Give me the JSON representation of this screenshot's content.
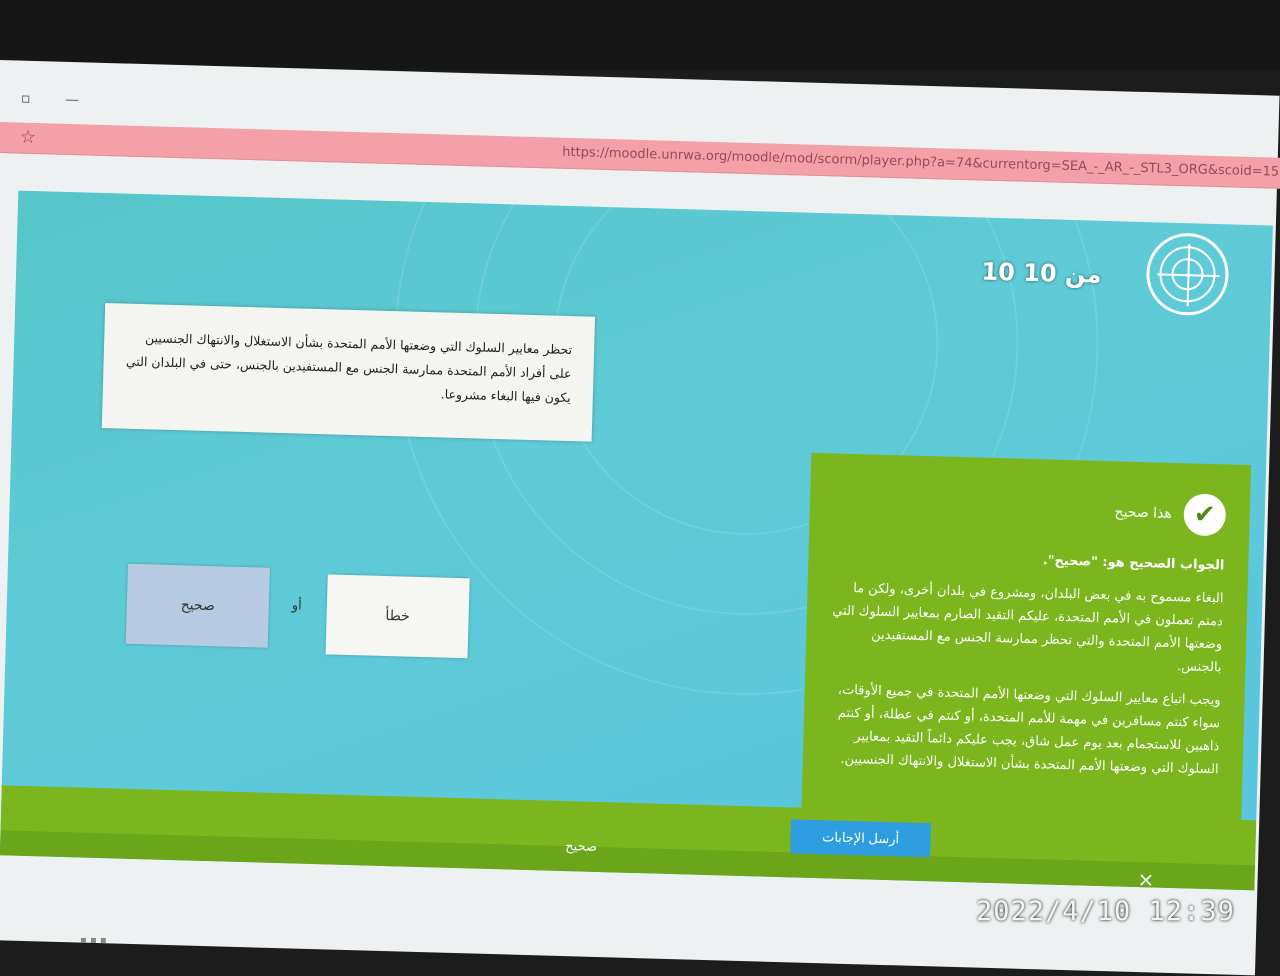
{
  "browser": {
    "url": "https://moodle.unrwa.org/moodle/mod/scorm/player.php?a=74&currentorg=SEA_-_AR_-_STL3_ORG&scoid=155"
  },
  "quiz": {
    "progress": "10 من 10",
    "question": "تحظر معايير السلوك التي وضعتها الأمم المتحدة بشأن الاستغلال والانتهاك الجنسيين على أفراد الأمم المتحدة ممارسة الجنس مع المستفيدين بالجنس، حتى في البلدان التي يكون فيها البغاء مشروعا.",
    "choices": {
      "true_label": "صحيح",
      "or_label": "أو",
      "false_label": "خطأ"
    },
    "feedback": {
      "title": "هذا صحيح",
      "answer": "الجواب الصحيح هو: \"صحيح\".",
      "para1": "البغاء مسموح به في بعض البلدان، ومشروع في بلدان أخرى، ولكن ما دمتم تعملون في الأمم المتحدة، عليكم التقيد الصارم بمعايير السلوك التي وضعتها الأمم المتحدة والتي تحظر ممارسة الجنس مع المستفيدين بالجنس.",
      "para2": "ويجب اتباع معايير السلوك التي وضعتها الأمم المتحدة في جميع الأوقات، سواء كنتم مسافرين في مهمة للأمم المتحدة، أو كنتم في عطلة، أو كنتم ذاهبين للاستجمام بعد يوم عمل شاق، يجب عليكم دائماً التقيد بمعايير السلوك التي وضعتها الأمم المتحدة بشأن الاستغلال والانتهاك الجنسيين."
    },
    "submit_label": "أرسل الإجابات",
    "status_label": "صحيح",
    "close_glyph": "×"
  },
  "photo": {
    "timestamp": "2022/4/10 12:39"
  },
  "colors": {
    "stage": "#5fcbd7",
    "feedback_green": "#7cb61e",
    "submit_blue": "#2d9de0",
    "address_bar": "#f4a0a8"
  }
}
